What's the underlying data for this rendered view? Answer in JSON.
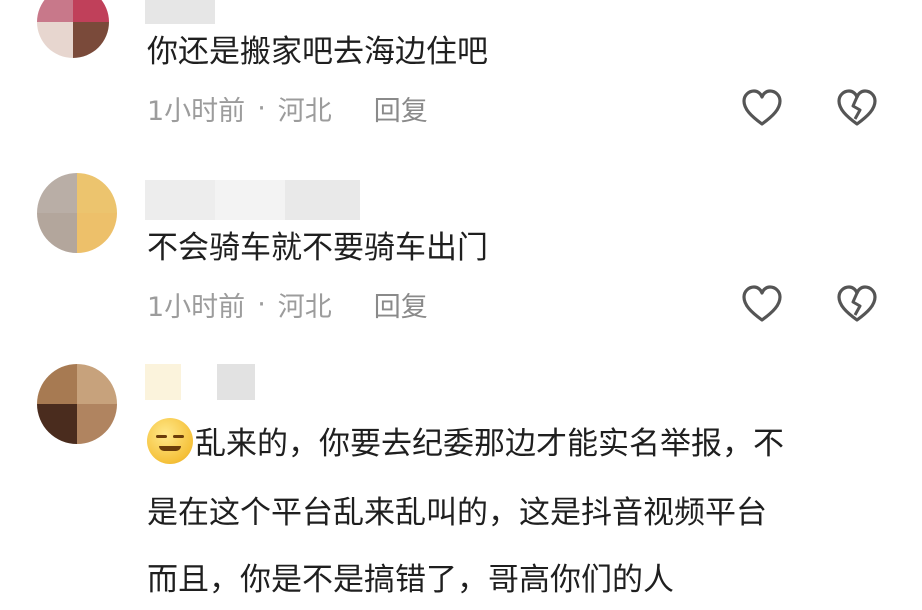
{
  "comments": [
    {
      "text": "你还是搬家吧去海边住吧",
      "time": "1小时前",
      "location": "河北",
      "reply": "回复"
    },
    {
      "text": "不会骑车就不要骑车出门",
      "time": "1小时前",
      "location": "河北",
      "reply": "回复"
    },
    {
      "lines": [
        "乱来的，你要去纪委那边才能实名举报，不",
        "是在这个平台乱来乱叫的，这是抖音视频平台",
        "而且，你是不是搞错了，哥高你们的人"
      ]
    }
  ],
  "icons": {
    "like": "heart-outline-icon",
    "dislike": "broken-heart-icon",
    "emoji": "laugh-emoji-icon"
  },
  "colors": {
    "text": "#1f1f1f",
    "meta": "#9c9c9c",
    "icon": "#555555"
  }
}
